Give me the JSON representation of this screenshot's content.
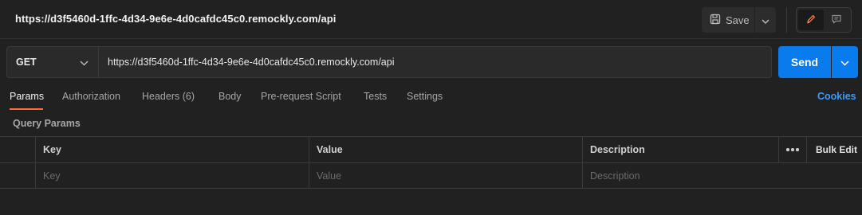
{
  "request": {
    "title": "https://d3f5460d-1ffc-4d34-9e6e-4d0cafdc45c0.remockly.com/api",
    "method": "GET",
    "url": "https://d3f5460d-1ffc-4d34-9e6e-4d0cafdc45c0.remockly.com/api"
  },
  "toolbar": {
    "save_label": "Save",
    "send_label": "Send"
  },
  "tabs": [
    {
      "label": "Params",
      "active": true
    },
    {
      "label": "Authorization"
    },
    {
      "label": "Headers (6)"
    },
    {
      "label": "Body"
    },
    {
      "label": "Pre-request Script"
    },
    {
      "label": "Tests"
    },
    {
      "label": "Settings"
    }
  ],
  "cookies_label": "Cookies",
  "query_params": {
    "section_label": "Query Params",
    "columns": [
      "Key",
      "Value",
      "Description"
    ],
    "bulk_edit_label": "Bulk Edit",
    "placeholders": {
      "key": "Key",
      "value": "Value",
      "description": "Description"
    }
  },
  "colors": {
    "accent": "#097bed",
    "active_tab_underline": "#ff6c37",
    "link": "#3d9bf6",
    "background": "#212121"
  },
  "icons": [
    "save-icon",
    "chevron-down-icon",
    "pencil-icon",
    "comment-icon",
    "more-horizontal-icon"
  ]
}
